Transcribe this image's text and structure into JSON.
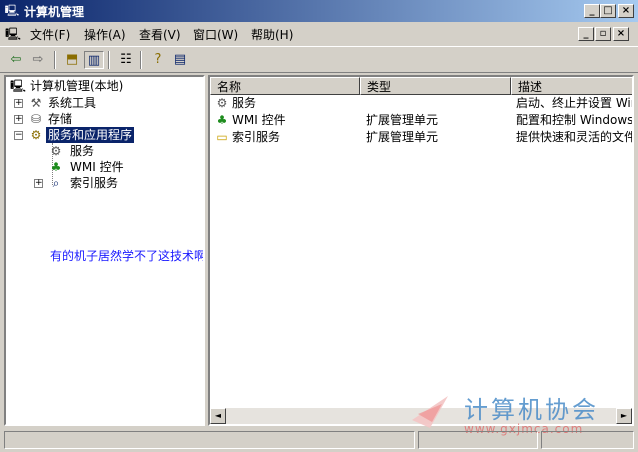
{
  "window": {
    "title": "计算机管理",
    "controls": [
      "_",
      "□",
      "×"
    ]
  },
  "menu": {
    "items": [
      "文件(F)",
      "操作(A)",
      "查看(V)",
      "窗口(W)",
      "帮助(H)"
    ],
    "mdi_controls": [
      "_",
      "▫",
      "×"
    ]
  },
  "tree": {
    "root": "计算机管理(本地)",
    "items": [
      {
        "label": "系统工具",
        "expander": "+"
      },
      {
        "label": "存储",
        "expander": "+"
      },
      {
        "label": "服务和应用程序",
        "expander": "−"
      },
      {
        "label": "服务",
        "expander": ""
      },
      {
        "label": "WMI 控件",
        "expander": ""
      },
      {
        "label": "索引服务",
        "expander": "+"
      }
    ],
    "annotation": "有的机子居然学不了这技术啊!"
  },
  "list": {
    "columns": [
      "名称",
      "类型",
      "描述"
    ],
    "rows": [
      {
        "name": "服务",
        "type": "",
        "desc": "启动、终止并设置 Win"
      },
      {
        "name": "WMI 控件",
        "type": "扩展管理单元",
        "desc": "配置和控制 Windows M"
      },
      {
        "name": "索引服务",
        "type": "扩展管理单元",
        "desc": "提供快速和灵活的文件"
      }
    ]
  },
  "scroll": {
    "left": "◄",
    "right": "►"
  },
  "watermark": {
    "title": "计算机协会",
    "url": "www.gxjmca.com"
  },
  "colors": {
    "titlebar_start": "#0a246a",
    "titlebar_end": "#a6caf0",
    "selection": "#0a246a",
    "annotation": "#1a1aff",
    "watermark": "#4a8cc8"
  }
}
